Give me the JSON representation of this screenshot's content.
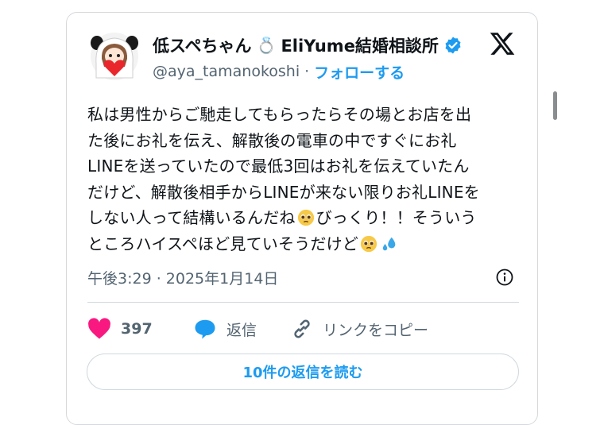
{
  "author": {
    "display_name_prefix": "低スペちゃん",
    "ring_emoji": "💍",
    "display_name_suffix": "EliYume結婚相談所",
    "verified_icon": "verified-badge-icon",
    "handle": "@aya_tamanokoshi",
    "separator": "·",
    "follow_label": "フォローする"
  },
  "platform_icon": "x-logo-icon",
  "tweet": {
    "lines": [
      "私は男性からご馳走してもらったらその場とお店を出",
      "た後にお礼を伝え、解散後の電車の中ですぐにお礼",
      "LINEを送っていたので最低3回はお礼を伝えていたん",
      "だけど、解散後相手からLINEが来ない限りお礼LINEを"
    ],
    "line5_before": "しない人って結構いるんだね",
    "line5_after": "びっくり！！そういう",
    "line6_before": "ところハイスペほど見ていそうだけど",
    "emoji_pleading": "🥺",
    "emoji_sweat": "💦"
  },
  "timestamp": "午後3:29 · 2025年1月14日",
  "actions": {
    "like_count": "397",
    "reply_label": "返信",
    "copy_link_label": "リンクをコピー"
  },
  "read_replies_label": "10件の返信を読む",
  "colors": {
    "accent": "#1d9bf0",
    "like": "#f91880",
    "text": "#0f1419",
    "muted": "#536471",
    "border": "#cfd9de"
  }
}
